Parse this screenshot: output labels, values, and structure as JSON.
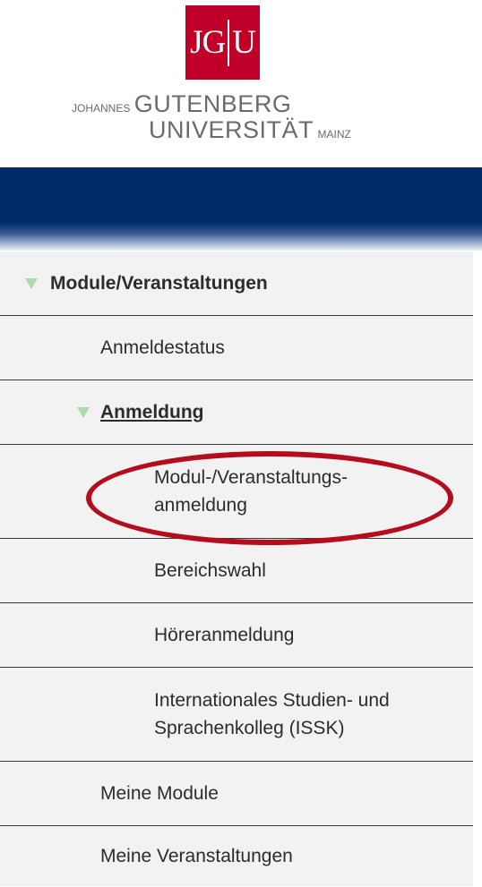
{
  "logo": {
    "mark_left": "JG",
    "mark_right": "U",
    "line1_small": "JOHANNES",
    "line1_big": "GUTENBERG",
    "line2_big": "UNIVERSITÄT",
    "line2_small": "MAINZ",
    "brand_color": "#c1002a"
  },
  "header": {
    "color": "#002b6b"
  },
  "menu": {
    "items": [
      {
        "label": "Module/Veranstaltungen",
        "level": 0,
        "expanded": true
      },
      {
        "label": "Anmeldestatus",
        "level": 1
      },
      {
        "label": "Anmeldung",
        "level": 1,
        "expanded": true,
        "active": true
      },
      {
        "label_line1": "Modul-/Veranstaltungs-",
        "label_line2": "anmeldung",
        "level": 2,
        "highlighted": true
      },
      {
        "label": "Bereichswahl",
        "level": 2
      },
      {
        "label": "Höreranmeldung",
        "level": 2
      },
      {
        "label_line1": "Internationales Studien- und",
        "label_line2": "Sprachenkolleg (ISSK)",
        "level": 2
      },
      {
        "label": "Meine Module",
        "level": 1
      },
      {
        "label": "Meine Veranstaltungen",
        "level": 1
      }
    ]
  },
  "icons": {
    "expand_arrow": "triangle-down-icon",
    "arrow_color": "#a9dba9"
  },
  "highlight": {
    "color": "#b40d1e",
    "shape": "ellipse"
  }
}
